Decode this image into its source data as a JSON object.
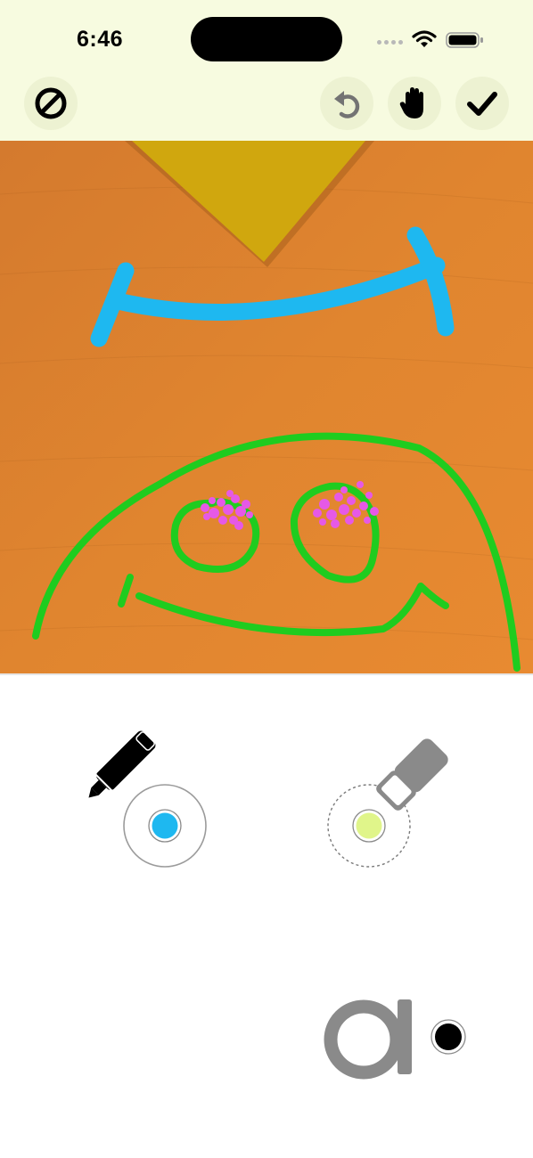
{
  "status_bar": {
    "time": "6:46"
  },
  "toolbar": {
    "buttons": [
      {
        "icon": "prohibit-icon"
      },
      {
        "icon": "undo-icon"
      },
      {
        "icon": "hand-icon"
      },
      {
        "icon": "checkmark-icon"
      }
    ]
  },
  "canvas": {
    "strokes": [
      {
        "color": "#1eb8f0",
        "shape": "bracket-smile"
      },
      {
        "color": "#1fcc1f",
        "shape": "face-outline"
      },
      {
        "color": "#1fcc1f",
        "shape": "left-eye"
      },
      {
        "color": "#1fcc1f",
        "shape": "right-eye"
      },
      {
        "color": "#1fcc1f",
        "shape": "mouth"
      },
      {
        "color": "#e659e6",
        "shape": "eye-sparkle-dots"
      }
    ],
    "background_photo": "orange-wooden-table-with-yellow-triangle"
  },
  "tools": {
    "pen": {
      "icon": "marker-pen-icon",
      "color": "#1eb8f0",
      "selected": true
    },
    "eraser": {
      "icon": "eraser-icon",
      "color": "#e0f58a",
      "selected": false
    },
    "text": {
      "glyph": "a",
      "color": "#000000"
    }
  }
}
